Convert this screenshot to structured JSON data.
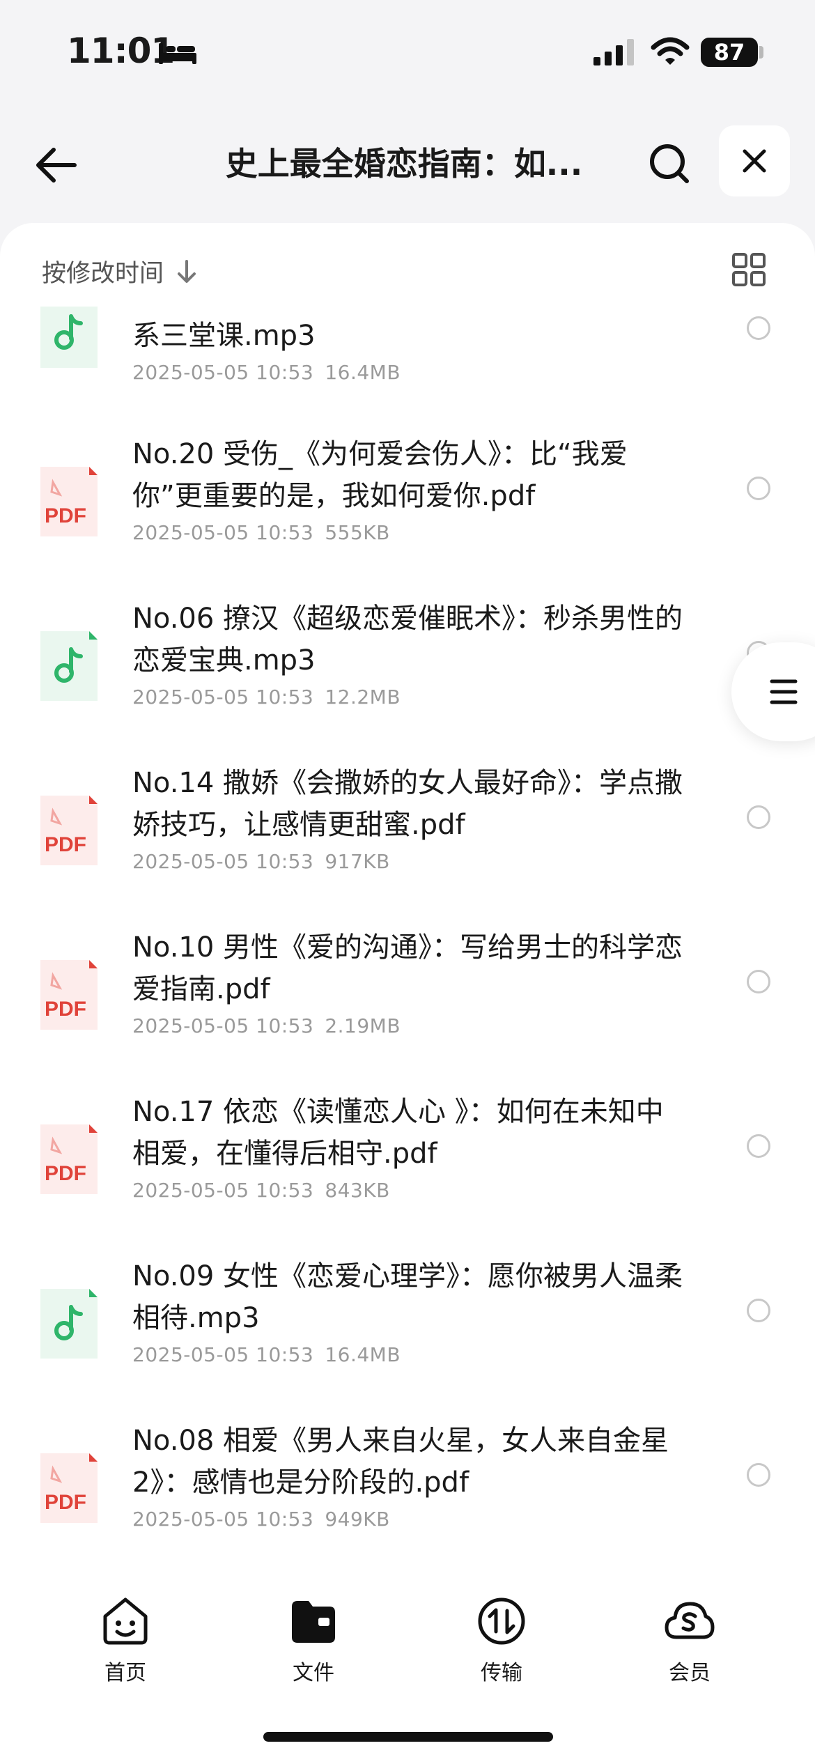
{
  "status_bar": {
    "time": "11:01",
    "battery": "87"
  },
  "header": {
    "title": "史上最全婚恋指南：如..."
  },
  "sort": {
    "label": "按修改时间"
  },
  "files": [
    {
      "name": "系三堂课.mp3",
      "date": "2025-05-05 10:53",
      "size": "16.4MB",
      "type": "mp3",
      "partial": true
    },
    {
      "name": "No.20 受伤_《为何爱会伤人》：比“我爱你”更重要的是，我如何爱你.pdf",
      "date": "2025-05-05 10:53",
      "size": "555KB",
      "type": "pdf"
    },
    {
      "name": "No.06 撩汉《超级恋爱催眠术》：秒杀男性的恋爱宝典.mp3",
      "date": "2025-05-05 10:53",
      "size": "12.2MB",
      "type": "mp3"
    },
    {
      "name": "No.14 撒娇《会撒娇的女人最好命》：学点撒娇技巧，让感情更甜蜜.pdf",
      "date": "2025-05-05 10:53",
      "size": "917KB",
      "type": "pdf"
    },
    {
      "name": "No.10 男性《爱的沟通》：写给男士的科学恋爱指南.pdf",
      "date": "2025-05-05 10:53",
      "size": "2.19MB",
      "type": "pdf"
    },
    {
      "name": "No.17 依恋《读懂恋人心 》：如何在未知中相爱，在懂得后相守.pdf",
      "date": "2025-05-05 10:53",
      "size": "843KB",
      "type": "pdf"
    },
    {
      "name": "No.09 女性《恋爱心理学》：愿你被男人温柔相待.mp3",
      "date": "2025-05-05 10:53",
      "size": "16.4MB",
      "type": "mp3"
    },
    {
      "name": "No.08 相爱《男人来自火星，女人来自金星2》：感情也是分阶段的.pdf",
      "date": "2025-05-05 10:53",
      "size": "949KB",
      "type": "pdf"
    }
  ],
  "pdf_badge": "PDF",
  "nav": [
    {
      "label": "首页",
      "icon": "smile-face-icon"
    },
    {
      "label": "文件",
      "icon": "folder-icon"
    },
    {
      "label": "传输",
      "icon": "transfer-icon"
    },
    {
      "label": "会员",
      "icon": "cloud-s-icon"
    }
  ],
  "colors": {
    "mp3_accent": "#2fb56a",
    "pdf_accent": "#e0433a",
    "panel_bg": "#ffffff",
    "page_bg": "#f4f4f6"
  }
}
